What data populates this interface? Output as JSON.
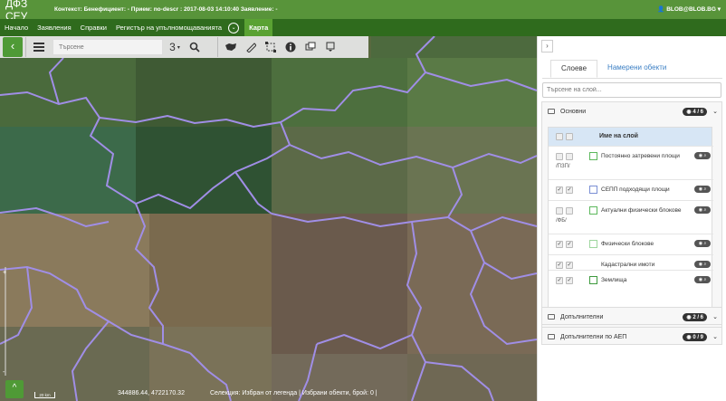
{
  "app": {
    "brand": "ДФЗ СЕУ",
    "context_line": "Контекст:  Бенефициент: -  Прием: no-descr : 2017-08-03 14:10:40  Заявление: -",
    "user": "BLOB@BLOB.BG"
  },
  "nav": {
    "items": [
      "Начало",
      "Заявления",
      "Справки",
      "Регистър на упълномощаванията"
    ],
    "dropdown_glyph": "⌄",
    "active": "Карта"
  },
  "toolbar": {
    "back_glyph": "‹",
    "search_placeholder": "Търсене",
    "zoom_level": "3"
  },
  "status": {
    "coords": "344886.44, 4722170.32",
    "selection": "Селекция: Избран от легенда | Избрани обекти, брой: 0 |",
    "scale": "20 km",
    "corner_glyph": "^"
  },
  "panel": {
    "collapse_glyph": "›",
    "tabs": [
      "Слоеве",
      "Намерени обекти"
    ],
    "search_placeholder": "Търсене на слой...",
    "groups": [
      {
        "name": "Основни",
        "badge": "4 / 6"
      },
      {
        "name": "Допълнителни",
        "badge": "2 / 6"
      },
      {
        "name": "Допълнителни по АЕП",
        "badge": "0 / 9"
      }
    ],
    "table_header": "Име на слой",
    "layers": [
      {
        "name": "Постоянно затревени площи",
        "suffix": "/ПЗП/",
        "checked": false,
        "color": "#5cb85c"
      },
      {
        "name": "СЕПП подходящи площи",
        "suffix": "",
        "checked": true,
        "color": "#7a8fd4"
      },
      {
        "name": "Актуални физически блокове",
        "suffix": "/ФБ/",
        "checked": false,
        "color": "#5cb85c"
      },
      {
        "name": "Физически блокове",
        "suffix": "",
        "checked": true,
        "color": "#9ed69e"
      },
      {
        "name": "Кадастрални имоти",
        "suffix": "",
        "checked": true,
        "color": "#ffffff"
      },
      {
        "name": "Землища",
        "suffix": "",
        "checked": true,
        "color": "#3d9a3d"
      }
    ],
    "colors": {
      "accent": "#4f9a36",
      "topbar": "#58943a",
      "navbar": "#2f6b1d",
      "link": "#3b7fc4"
    }
  }
}
